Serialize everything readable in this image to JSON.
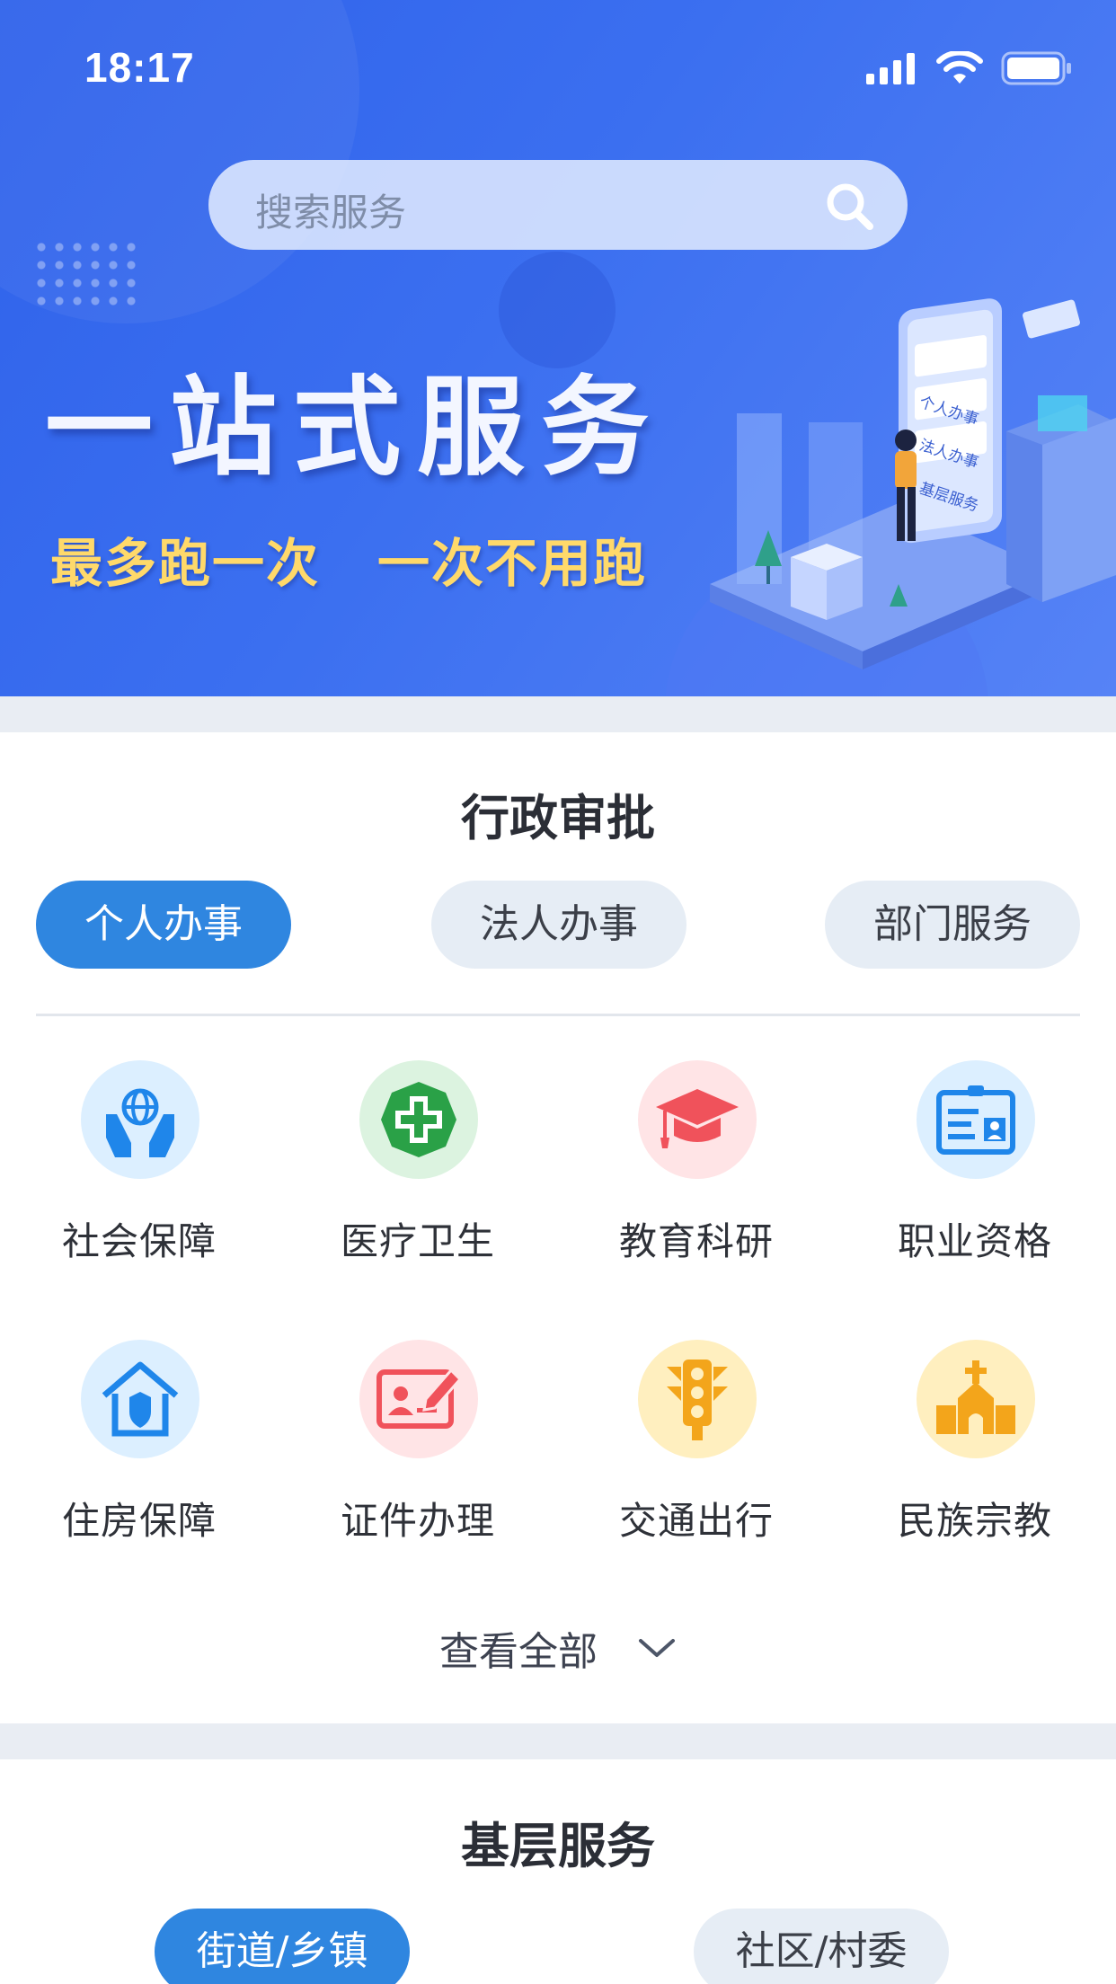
{
  "status_bar": {
    "time": "18:17"
  },
  "search": {
    "placeholder": "搜索服务"
  },
  "banner": {
    "headline": "一站式服务",
    "subline_1": "最多跑一次",
    "subline_2": "一次不用跑",
    "phone_cards": [
      "个人办事",
      "法人办事",
      "基层服务"
    ]
  },
  "section_approval": {
    "title": "行政审批",
    "tabs": [
      {
        "label": "个人办事",
        "active": true
      },
      {
        "label": "法人办事",
        "active": false
      },
      {
        "label": "部门服务",
        "active": false
      }
    ],
    "services": [
      {
        "label": "社会保障",
        "icon": "hands-globe-icon",
        "color": "#1f86ea"
      },
      {
        "label": "医疗卫生",
        "icon": "medical-cross-icon",
        "color": "#2aa147"
      },
      {
        "label": "教育科研",
        "icon": "graduation-cap-icon",
        "color": "#f0525b"
      },
      {
        "label": "职业资格",
        "icon": "id-badge-icon",
        "color": "#1f86ea"
      },
      {
        "label": "住房保障",
        "icon": "house-shield-icon",
        "color": "#1f86ea"
      },
      {
        "label": "证件办理",
        "icon": "id-card-pen-icon",
        "color": "#f0525b"
      },
      {
        "label": "交通出行",
        "icon": "traffic-light-icon",
        "color": "#f3a51b"
      },
      {
        "label": "民族宗教",
        "icon": "temple-icon",
        "color": "#f3a51b"
      }
    ],
    "view_all": "查看全部"
  },
  "section_grassroots": {
    "title": "基层服务",
    "tabs": [
      {
        "label": "街道/乡镇",
        "active": true
      },
      {
        "label": "社区/村委",
        "active": false
      }
    ]
  }
}
